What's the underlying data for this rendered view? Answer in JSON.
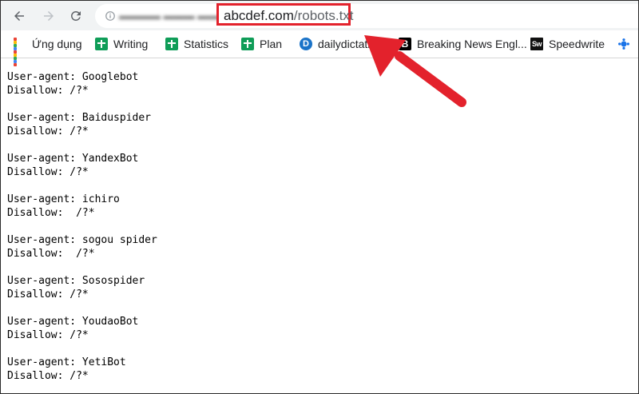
{
  "toolbar": {
    "back_icon": "arrow-left-icon",
    "forward_icon": "arrow-right-icon",
    "reload_icon": "reload-icon",
    "url_domain": "abcdef.com",
    "url_path": "/robots.txt"
  },
  "bookmarks": [
    {
      "label": "Ứng dụng",
      "icon": "apps-grid-icon"
    },
    {
      "label": "Writing",
      "icon": "google-sheets-icon"
    },
    {
      "label": "Statistics",
      "icon": "google-sheets-icon"
    },
    {
      "label": "Plan",
      "icon": "google-sheets-icon"
    },
    {
      "label": "dailydictation",
      "icon": "dailydictation-icon"
    },
    {
      "label": "Breaking News Engl...",
      "icon": "breaking-news-icon",
      "icon_text": "B"
    },
    {
      "label": "Speedwrite",
      "icon": "speedwrite-icon",
      "icon_text": "Sw"
    }
  ],
  "robots": [
    {
      "agent": "User-agent: Googlebot",
      "disallow": "Disallow: /?*"
    },
    {
      "agent": "User-agent: Baiduspider",
      "disallow": "Disallow: /?*"
    },
    {
      "agent": "User-agent: YandexBot",
      "disallow": "Disallow: /?*"
    },
    {
      "agent": "User-agent: ichiro",
      "disallow": "Disallow:  /?*"
    },
    {
      "agent": "User-agent: sogou spider",
      "disallow": "Disallow:  /?*"
    },
    {
      "agent": "User-agent: Sosospider",
      "disallow": "Disallow: /?*"
    },
    {
      "agent": "User-agent: YoudaoBot",
      "disallow": "Disallow: /?*"
    },
    {
      "agent": "User-agent: YetiBot",
      "disallow": "Disallow: /?*"
    }
  ],
  "colors": {
    "annotation_red": "#e3222c",
    "sheets_green": "#0f9d58",
    "toolbar_bg": "#f1f3f4"
  }
}
